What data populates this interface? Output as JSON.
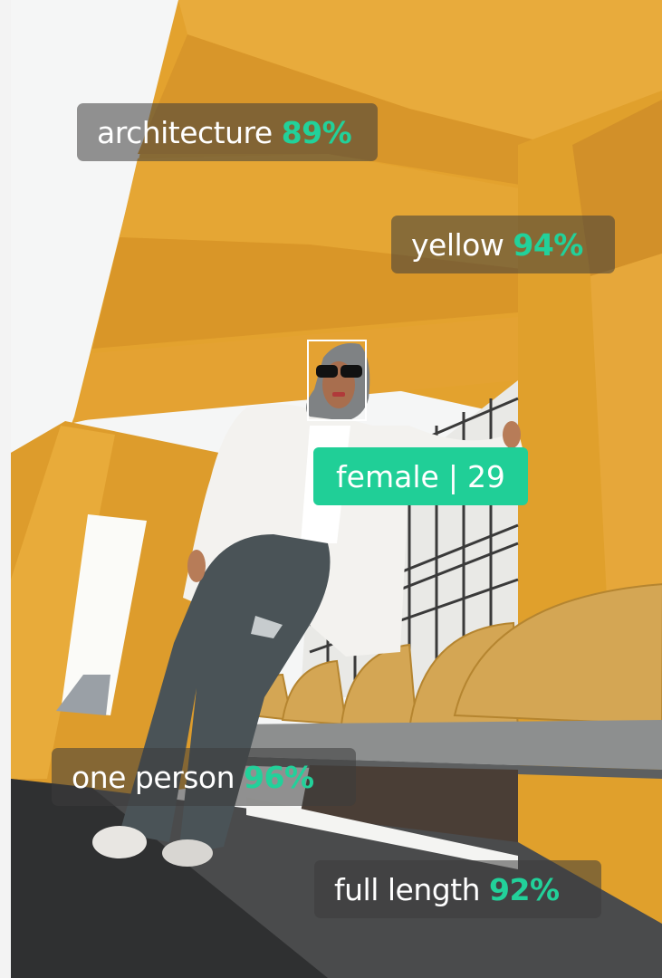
{
  "tags": {
    "architecture": {
      "label": "architecture",
      "confidence": "89%"
    },
    "yellow": {
      "label": "yellow",
      "confidence": "94%"
    },
    "one_person": {
      "label": "one person",
      "confidence": "96%"
    },
    "full_length": {
      "label": "full length",
      "confidence": "92%"
    }
  },
  "face": {
    "gender": "female",
    "separator": "|",
    "age": "29"
  },
  "colors": {
    "tag_bg": "#3c3c3c",
    "confidence": "#22d19a",
    "face_badge": "#20cf97",
    "wall": "#e4a22a"
  }
}
